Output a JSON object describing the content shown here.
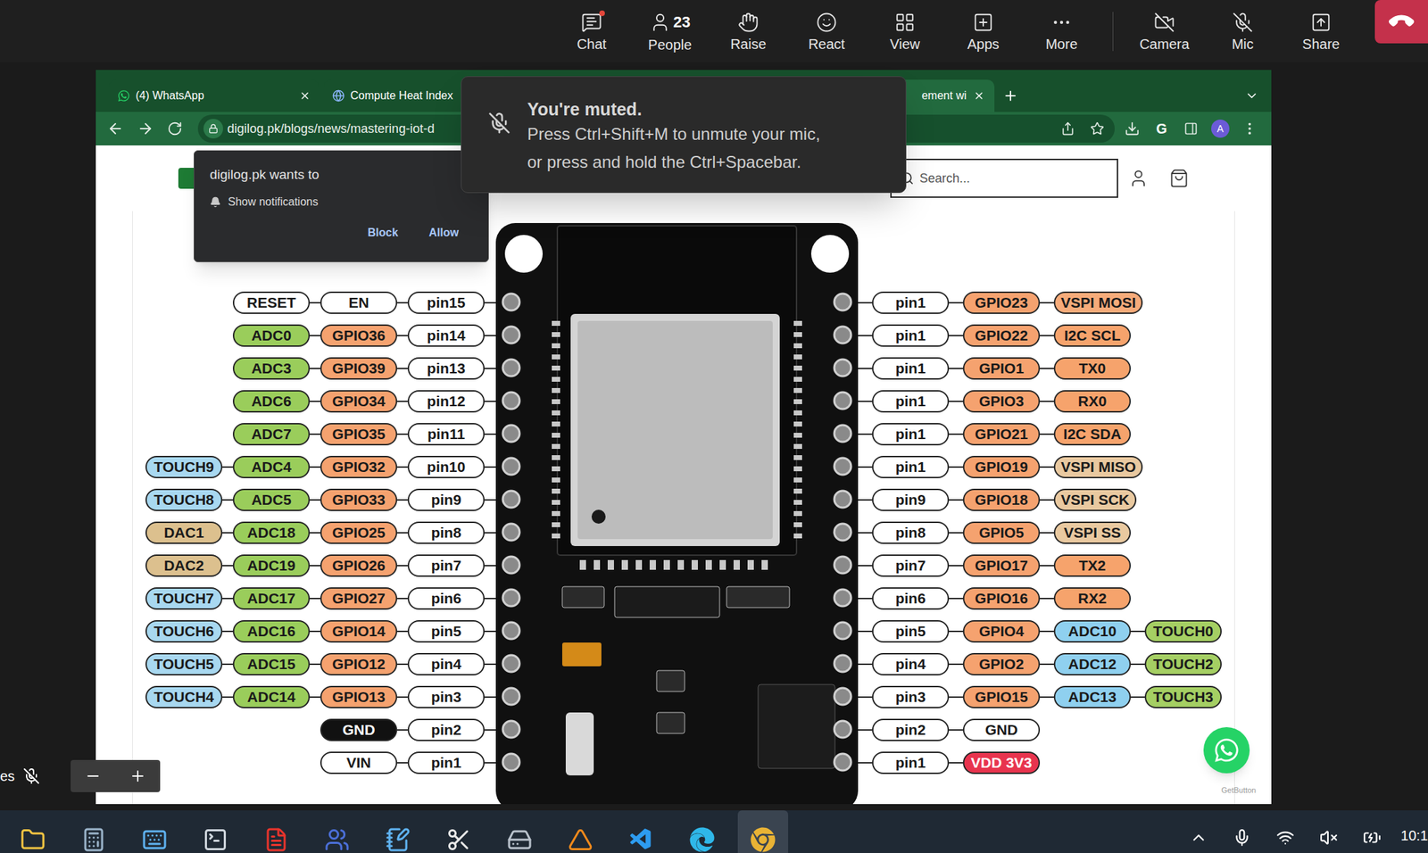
{
  "meeting_toolbar": {
    "buttons": [
      {
        "label": "Chat",
        "badge": true
      },
      {
        "label": "People",
        "count": "23",
        "badge": false
      },
      {
        "label": "Raise",
        "badge": false
      },
      {
        "label": "React",
        "badge": false
      },
      {
        "label": "View",
        "badge": false
      },
      {
        "label": "Apps",
        "badge": false
      },
      {
        "label": "More",
        "badge": false
      }
    ],
    "device_buttons": [
      {
        "label": "Camera",
        "off": true
      },
      {
        "label": "Mic",
        "off": true
      },
      {
        "label": "Share",
        "off": false
      }
    ]
  },
  "muted_toast": {
    "title": "You're muted.",
    "lines": [
      "Press Ctrl+Shift+M to unmute your mic,",
      "or press and hold the Ctrl+Spacebar."
    ]
  },
  "browser": {
    "tabs": [
      {
        "label": "(4) WhatsApp",
        "selected": false
      },
      {
        "label": "Compute Heat Index",
        "selected": false
      },
      {
        "label": "ement wi",
        "selected": true
      }
    ],
    "address": "digilog.pk/blogs/news/mastering-iot-d",
    "extension": "G",
    "profile": "A"
  },
  "notification_prompt": {
    "title": "digilog.pk wants to",
    "item": "Show notifications",
    "buttons": [
      "Block",
      "Allow"
    ]
  },
  "page": {
    "search_placeholder": "Search...",
    "chat_widget_caption": "GetButton",
    "pinout": {
      "left": [
        {
          "labels": [
            {
              "text": "RESET",
              "color": "#ffffff"
            },
            {
              "text": "EN",
              "color": "#ffffff"
            },
            {
              "text": "pin15",
              "color": "#ffffff"
            }
          ]
        },
        {
          "labels": [
            {
              "text": "ADC0",
              "color": "#9acd5b"
            },
            {
              "text": "GPIO36",
              "color": "#f5a26f"
            },
            {
              "text": "pin14",
              "color": "#ffffff"
            }
          ]
        },
        {
          "labels": [
            {
              "text": "ADC3",
              "color": "#9acd5b"
            },
            {
              "text": "GPIO39",
              "color": "#f5a26f"
            },
            {
              "text": "pin13",
              "color": "#ffffff"
            }
          ]
        },
        {
          "labels": [
            {
              "text": "ADC6",
              "color": "#9acd5b"
            },
            {
              "text": "GPIO34",
              "color": "#f5a26f"
            },
            {
              "text": "pin12",
              "color": "#ffffff"
            }
          ]
        },
        {
          "labels": [
            {
              "text": "ADC7",
              "color": "#9acd5b"
            },
            {
              "text": "GPIO35",
              "color": "#f5a26f"
            },
            {
              "text": "pin11",
              "color": "#ffffff"
            }
          ]
        },
        {
          "labels": [
            {
              "text": "TOUCH9",
              "color": "#a8d8f0"
            },
            {
              "text": "ADC4",
              "color": "#9acd5b"
            },
            {
              "text": "GPIO32",
              "color": "#f5a26f"
            },
            {
              "text": "pin10",
              "color": "#ffffff"
            }
          ]
        },
        {
          "labels": [
            {
              "text": "TOUCH8",
              "color": "#a8d8f0"
            },
            {
              "text": "ADC5",
              "color": "#9acd5b"
            },
            {
              "text": "GPIO33",
              "color": "#f5a26f"
            },
            {
              "text": "pin9",
              "color": "#ffffff"
            }
          ]
        },
        {
          "labels": [
            {
              "text": "DAC1",
              "color": "#dcc08e"
            },
            {
              "text": "ADC18",
              "color": "#9acd5b"
            },
            {
              "text": "GPIO25",
              "color": "#f5a26f"
            },
            {
              "text": "pin8",
              "color": "#ffffff"
            }
          ]
        },
        {
          "labels": [
            {
              "text": "DAC2",
              "color": "#dcc08e"
            },
            {
              "text": "ADC19",
              "color": "#9acd5b"
            },
            {
              "text": "GPIO26",
              "color": "#f5a26f"
            },
            {
              "text": "pin7",
              "color": "#ffffff"
            }
          ]
        },
        {
          "labels": [
            {
              "text": "TOUCH7",
              "color": "#a8d8f0"
            },
            {
              "text": "ADC17",
              "color": "#9acd5b"
            },
            {
              "text": "GPIO27",
              "color": "#f5a26f"
            },
            {
              "text": "pin6",
              "color": "#ffffff"
            }
          ]
        },
        {
          "labels": [
            {
              "text": "TOUCH6",
              "color": "#a8d8f0"
            },
            {
              "text": "ADC16",
              "color": "#9acd5b"
            },
            {
              "text": "GPIO14",
              "color": "#f5a26f"
            },
            {
              "text": "pin5",
              "color": "#ffffff"
            }
          ]
        },
        {
          "labels": [
            {
              "text": "TOUCH5",
              "color": "#a8d8f0"
            },
            {
              "text": "ADC15",
              "color": "#9acd5b"
            },
            {
              "text": "GPIO12",
              "color": "#f5a26f"
            },
            {
              "text": "pin4",
              "color": "#ffffff"
            }
          ]
        },
        {
          "labels": [
            {
              "text": "TOUCH4",
              "color": "#a8d8f0"
            },
            {
              "text": "ADC14",
              "color": "#9acd5b"
            },
            {
              "text": "GPIO13",
              "color": "#f5a26f"
            },
            {
              "text": "pin3",
              "color": "#ffffff"
            }
          ]
        },
        {
          "labels": [
            {
              "text": "GND",
              "color": "#111111"
            },
            {
              "text": "pin2",
              "color": "#ffffff"
            }
          ]
        },
        {
          "labels": [
            {
              "text": "VIN",
              "color": "#ffffff"
            },
            {
              "text": "pin1",
              "color": "#ffffff"
            }
          ]
        }
      ],
      "right": [
        {
          "labels": [
            {
              "text": "pin1",
              "color": "#ffffff"
            },
            {
              "text": "GPIO23",
              "color": "#f5a26f"
            },
            {
              "text": "VSPI MOSI",
              "color": "#f6ab7a"
            }
          ]
        },
        {
          "labels": [
            {
              "text": "pin1",
              "color": "#ffffff"
            },
            {
              "text": "GPIO22",
              "color": "#f5a26f"
            },
            {
              "text": "I2C SCL",
              "color": "#f6a36c"
            }
          ]
        },
        {
          "labels": [
            {
              "text": "pin1",
              "color": "#ffffff"
            },
            {
              "text": "GPIO1",
              "color": "#f5a26f"
            },
            {
              "text": "TX0",
              "color": "#f6a36c"
            }
          ]
        },
        {
          "labels": [
            {
              "text": "pin1",
              "color": "#ffffff"
            },
            {
              "text": "GPIO3",
              "color": "#f5a26f"
            },
            {
              "text": "RX0",
              "color": "#f6a36c"
            }
          ]
        },
        {
          "labels": [
            {
              "text": "pin1",
              "color": "#ffffff"
            },
            {
              "text": "GPIO21",
              "color": "#f5a26f"
            },
            {
              "text": "I2C SDA",
              "color": "#f6a36c"
            }
          ]
        },
        {
          "labels": [
            {
              "text": "pin1",
              "color": "#ffffff"
            },
            {
              "text": "GPIO19",
              "color": "#f5a26f"
            },
            {
              "text": "VSPI MISO",
              "color": "#e9c9a0"
            }
          ]
        },
        {
          "labels": [
            {
              "text": "pin9",
              "color": "#ffffff"
            },
            {
              "text": "GPIO18",
              "color": "#f5a26f"
            },
            {
              "text": "VSPI SCK",
              "color": "#e9c9a0"
            }
          ]
        },
        {
          "labels": [
            {
              "text": "pin8",
              "color": "#ffffff"
            },
            {
              "text": "GPIO5",
              "color": "#f5a26f"
            },
            {
              "text": "VSPI SS",
              "color": "#e9c9a0"
            }
          ]
        },
        {
          "labels": [
            {
              "text": "pin7",
              "color": "#ffffff"
            },
            {
              "text": "GPIO17",
              "color": "#f5a26f"
            },
            {
              "text": "TX2",
              "color": "#f6a36c"
            }
          ]
        },
        {
          "labels": [
            {
              "text": "pin6",
              "color": "#ffffff"
            },
            {
              "text": "GPIO16",
              "color": "#f5a26f"
            },
            {
              "text": "RX2",
              "color": "#f6a36c"
            }
          ]
        },
        {
          "labels": [
            {
              "text": "pin5",
              "color": "#ffffff"
            },
            {
              "text": "GPIO4",
              "color": "#f5a26f"
            },
            {
              "text": "ADC10",
              "color": "#8fd0ef"
            },
            {
              "text": "TOUCH0",
              "color": "#a5cf63"
            }
          ]
        },
        {
          "labels": [
            {
              "text": "pin4",
              "color": "#ffffff"
            },
            {
              "text": "GPIO2",
              "color": "#f5a26f"
            },
            {
              "text": "ADC12",
              "color": "#8fd0ef"
            },
            {
              "text": "TOUCH2",
              "color": "#a5cf63"
            }
          ]
        },
        {
          "labels": [
            {
              "text": "pin3",
              "color": "#ffffff"
            },
            {
              "text": "GPIO15",
              "color": "#f5a26f"
            },
            {
              "text": "ADC13",
              "color": "#8fd0ef"
            },
            {
              "text": "TOUCH3",
              "color": "#a5cf63"
            }
          ]
        },
        {
          "labels": [
            {
              "text": "pin2",
              "color": "#ffffff"
            },
            {
              "text": "GND",
              "color": "#ffffff"
            }
          ]
        },
        {
          "labels": [
            {
              "text": "pin1",
              "color": "#ffffff"
            },
            {
              "text": "VDD 3V3",
              "color": "#e8344e"
            }
          ]
        }
      ]
    }
  },
  "participant": {
    "name": "es",
    "muted": true
  },
  "taskbar": {
    "apps": [
      {
        "active": false
      },
      {
        "active": false
      },
      {
        "active": false
      },
      {
        "active": false
      },
      {
        "active": false
      },
      {
        "active": false
      },
      {
        "active": false
      },
      {
        "active": false
      },
      {
        "active": false
      },
      {
        "active": false
      },
      {
        "active": false
      },
      {
        "active": false
      },
      {
        "active": true
      }
    ],
    "clock": "10:1",
    "speaker_muted": true
  }
}
